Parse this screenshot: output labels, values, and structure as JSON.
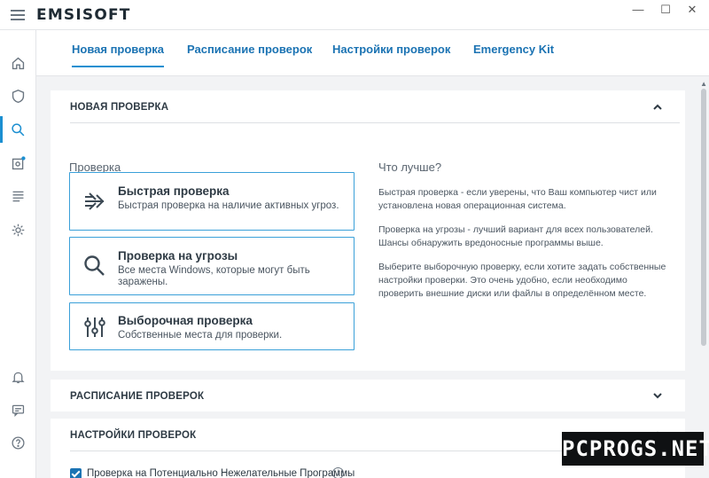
{
  "app": {
    "brand": "EMSISOFT"
  },
  "window": {
    "minimize": "—",
    "maximize": "☐",
    "close": "✕"
  },
  "sidebar": {
    "items": [
      {
        "icon": "home-icon"
      },
      {
        "icon": "shield-icon"
      },
      {
        "icon": "search-icon",
        "active": true
      },
      {
        "icon": "quarantine-icon",
        "badge": true
      },
      {
        "icon": "logs-icon"
      },
      {
        "icon": "gear-icon"
      },
      {
        "icon": "bell-icon"
      },
      {
        "icon": "chat-icon"
      },
      {
        "icon": "help-icon"
      }
    ]
  },
  "tabs": [
    {
      "label": "Новая проверка",
      "active": true
    },
    {
      "label": "Расписание проверок"
    },
    {
      "label": "Настройки проверок"
    },
    {
      "label": "Emergency Kit"
    }
  ],
  "new_scan": {
    "header": "НОВАЯ ПРОВЕРКА",
    "scan_label": "Проверка",
    "options": [
      {
        "title": "Быстрая проверка",
        "desc": "Быстрая проверка на наличие активных угроз.",
        "icon": "quick-scan-icon"
      },
      {
        "title": "Проверка на угрозы",
        "desc": "Все места Windows, которые могут быть заражены.",
        "icon": "malware-scan-icon"
      },
      {
        "title": "Выборочная проверка",
        "desc": "Собственные места для проверки.",
        "icon": "custom-scan-icon"
      }
    ],
    "help": {
      "title": "Что лучше?",
      "p1": "Быстрая проверка - если уверены, что Ваш компьютер чист или установлена новая операционная система.",
      "p2": "Проверка на угрозы - лучший вариант для всех пользователей. Шансы обнаружить вредоносные программы выше.",
      "p3": "Выберите выборочную проверку, если хотите задать собственные настройки проверки. Это очень удобно, если необходимо проверить внешние диски или файлы в определённом месте."
    }
  },
  "scheduled": {
    "header": "РАСПИСАНИЕ ПРОВЕРОК"
  },
  "settings": {
    "header": "НАСТРОЙКИ ПРОВЕРОК",
    "checkbox_label": "Проверка на Потенциально Нежелательные Программы",
    "checked": true
  },
  "watermark": "PCPROGS.NET",
  "colors": {
    "accent": "#1b8fd1",
    "tab_text": "#1b73b3",
    "card_border": "#3aa0d9"
  }
}
